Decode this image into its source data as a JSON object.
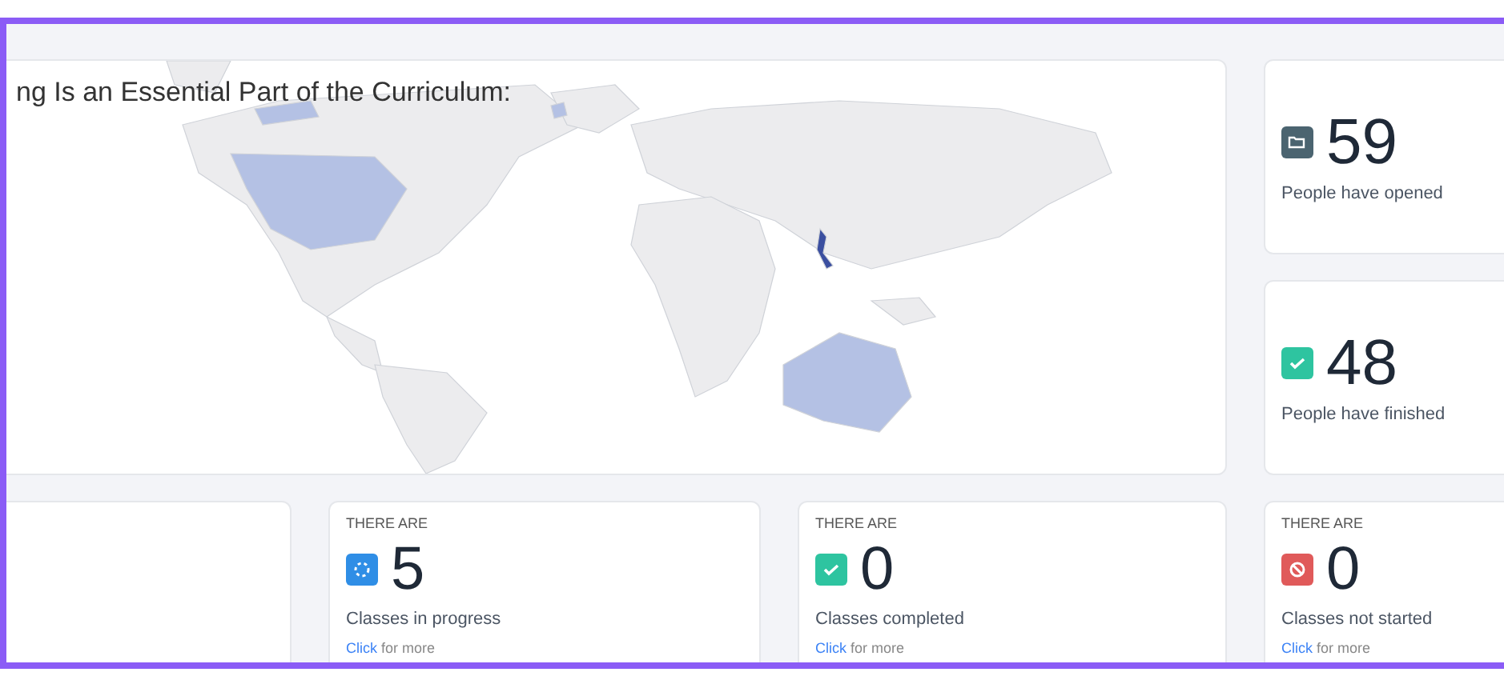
{
  "map_card": {
    "title": "ng Is an Essential Part of the Curriculum:"
  },
  "people_stats": [
    {
      "kind": "opened",
      "value": "59",
      "label": "People have opened"
    },
    {
      "kind": "finished",
      "value": "48",
      "label": "People have finished"
    }
  ],
  "class_stats": [
    {
      "kind": "progress",
      "eyebrow": "THERE ARE",
      "value": "5",
      "label": "Classes in progress",
      "link": "Click",
      "link_suffix": "for more"
    },
    {
      "kind": "completed",
      "eyebrow": "THERE ARE",
      "value": "0",
      "label": "Classes completed",
      "link": "Click",
      "link_suffix": "for more"
    },
    {
      "kind": "not_started",
      "eyebrow": "THERE ARE",
      "value": "0",
      "label": "Classes not started",
      "link": "Click",
      "link_suffix": "for more"
    }
  ]
}
